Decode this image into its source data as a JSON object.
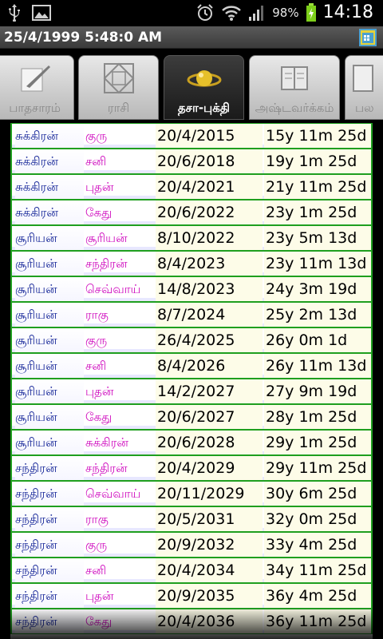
{
  "status_bar": {
    "battery_text": "98%",
    "time": "14:18",
    "icons": [
      "usb-icon",
      "image-icon",
      "alarm-icon",
      "wifi-icon",
      "signal-icon",
      "battery-charging-icon"
    ]
  },
  "title_bar": {
    "title": "25/4/1999 5:48:0 AM",
    "icon": "calendar-icon"
  },
  "tabs": [
    {
      "label": "பாதசாரம்",
      "icon": "quill-icon",
      "active": false
    },
    {
      "label": "ராசி",
      "icon": "chart-grid-icon",
      "active": false
    },
    {
      "label": "தசா-புக்தி",
      "icon": "planet-icon",
      "active": true
    },
    {
      "label": "அஷ்டவர்க்கம்",
      "icon": "book-icon",
      "active": false
    },
    {
      "label": "பல",
      "icon": "doc-icon",
      "active": false
    }
  ],
  "rows": [
    {
      "dasa": "சுக்கிரன்",
      "bukthi": "குரு",
      "date": "20/4/2015",
      "duration": "15y 11m 25d"
    },
    {
      "dasa": "சுக்கிரன்",
      "bukthi": "சனி",
      "date": "20/6/2018",
      "duration": "19y 1m 25d"
    },
    {
      "dasa": "சுக்கிரன்",
      "bukthi": "புதன்",
      "date": "20/4/2021",
      "duration": "21y 11m 25d"
    },
    {
      "dasa": "சுக்கிரன்",
      "bukthi": "கேது",
      "date": "20/6/2022",
      "duration": "23y 1m 25d"
    },
    {
      "dasa": "சூரியன்",
      "bukthi": "சூரியன்",
      "date": "8/10/2022",
      "duration": "23y 5m 13d"
    },
    {
      "dasa": "சூரியன்",
      "bukthi": "சந்திரன்",
      "date": "8/4/2023",
      "duration": "23y 11m 13d"
    },
    {
      "dasa": "சூரியன்",
      "bukthi": "செவ்வாய்",
      "date": "14/8/2023",
      "duration": "24y 3m 19d"
    },
    {
      "dasa": "சூரியன்",
      "bukthi": "ராகு",
      "date": "8/7/2024",
      "duration": "25y 2m 13d"
    },
    {
      "dasa": "சூரியன்",
      "bukthi": "குரு",
      "date": "26/4/2025",
      "duration": "26y 0m 1d"
    },
    {
      "dasa": "சூரியன்",
      "bukthi": "சனி",
      "date": "8/4/2026",
      "duration": "26y 11m 13d"
    },
    {
      "dasa": "சூரியன்",
      "bukthi": "புதன்",
      "date": "14/2/2027",
      "duration": "27y 9m 19d"
    },
    {
      "dasa": "சூரியன்",
      "bukthi": "கேது",
      "date": "20/6/2027",
      "duration": "28y 1m 25d"
    },
    {
      "dasa": "சூரியன்",
      "bukthi": "சுக்கிரன்",
      "date": "20/6/2028",
      "duration": "29y 1m 25d"
    },
    {
      "dasa": "சந்திரன்",
      "bukthi": "சந்திரன்",
      "date": "20/4/2029",
      "duration": "29y 11m 25d"
    },
    {
      "dasa": "சந்திரன்",
      "bukthi": "செவ்வாய்",
      "date": "20/11/2029",
      "duration": "30y 6m 25d"
    },
    {
      "dasa": "சந்திரன்",
      "bukthi": "ராகு",
      "date": "20/5/2031",
      "duration": "32y 0m 25d"
    },
    {
      "dasa": "சந்திரன்",
      "bukthi": "குரு",
      "date": "20/9/2032",
      "duration": "33y 4m 25d"
    },
    {
      "dasa": "சந்திரன்",
      "bukthi": "சனி",
      "date": "20/4/2034",
      "duration": "34y 11m 25d"
    },
    {
      "dasa": "சந்திரன்",
      "bukthi": "புதன்",
      "date": "20/9/2035",
      "duration": "36y 4m 25d"
    },
    {
      "dasa": "சந்திரன்",
      "bukthi": "கேது",
      "date": "20/4/2036",
      "duration": "36y 11m 25d"
    }
  ],
  "colors": {
    "row_border": "#1f9f1f",
    "dasa_text": "#1a2a9a",
    "bukthi_text": "#d010c0",
    "date_bg": "#fdfce8"
  }
}
